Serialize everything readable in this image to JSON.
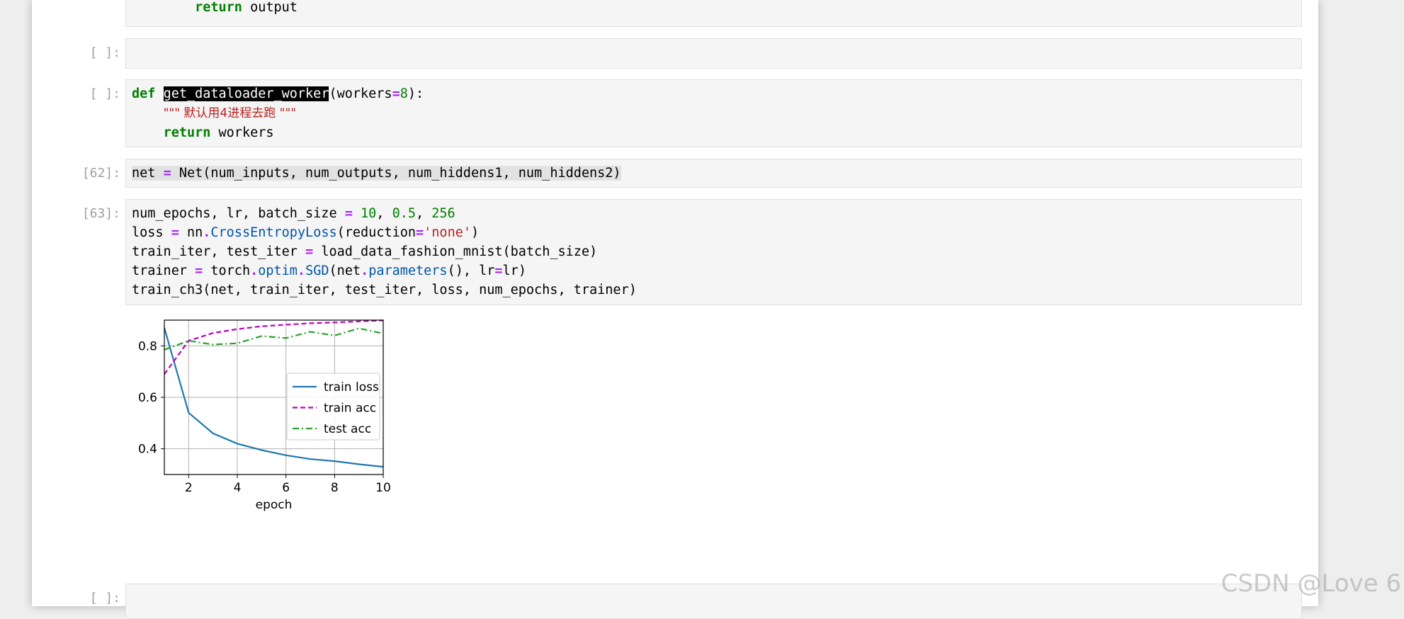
{
  "cells": [
    {
      "prompt": "",
      "lines": [
        [
          {
            "t": "        "
          },
          {
            "t": "return",
            "c": "kw"
          },
          {
            "t": " output"
          }
        ]
      ]
    },
    {
      "prompt": "[ ]:",
      "lines": [
        [
          {
            "t": ""
          }
        ]
      ]
    },
    {
      "prompt": "[ ]:",
      "lines": [
        [
          {
            "t": "def",
            "c": "kw"
          },
          {
            "t": " "
          },
          {
            "t": "get_dataloader_worker",
            "c": "sel"
          },
          {
            "t": "(workers"
          },
          {
            "t": "=",
            "c": "op"
          },
          {
            "t": "8",
            "c": "num"
          },
          {
            "t": "):"
          }
        ],
        [
          {
            "t": "    "
          },
          {
            "t": "\"\"\" 默认用4进程去跑 \"\"\"",
            "c": "str"
          }
        ],
        [
          {
            "t": "    "
          },
          {
            "t": "return",
            "c": "kw"
          },
          {
            "t": " workers"
          }
        ]
      ]
    },
    {
      "prompt": "[62]:",
      "lines": [
        [
          {
            "t": "net ",
            "c": "hl"
          },
          {
            "t": "=",
            "c": "op hl"
          },
          {
            "t": " Net(num_inputs, num_outputs, num_hiddens1, num_hiddens2)",
            "c": "hl"
          }
        ]
      ]
    },
    {
      "prompt": "[63]:",
      "lines": [
        [
          {
            "t": "num_epochs, lr, batch_size "
          },
          {
            "t": "=",
            "c": "op"
          },
          {
            "t": " "
          },
          {
            "t": "10",
            "c": "num"
          },
          {
            "t": ", "
          },
          {
            "t": "0.5",
            "c": "num"
          },
          {
            "t": ", "
          },
          {
            "t": "256",
            "c": "num"
          }
        ],
        [
          {
            "t": "loss "
          },
          {
            "t": "=",
            "c": "op"
          },
          {
            "t": " nn"
          },
          {
            "t": ".",
            "c": "op"
          },
          {
            "t": "CrossEntropyLoss",
            "c": "fn"
          },
          {
            "t": "(reduction"
          },
          {
            "t": "=",
            "c": "op"
          },
          {
            "t": "'none'",
            "c": "str"
          },
          {
            "t": ")"
          }
        ],
        [
          {
            "t": "train_iter, test_iter "
          },
          {
            "t": "=",
            "c": "op"
          },
          {
            "t": " load_data_fashion_mnist(batch_size)"
          }
        ],
        [
          {
            "t": "trainer "
          },
          {
            "t": "=",
            "c": "op"
          },
          {
            "t": " torch"
          },
          {
            "t": ".",
            "c": "op"
          },
          {
            "t": "optim",
            "c": "fn"
          },
          {
            "t": ".",
            "c": "op"
          },
          {
            "t": "SGD",
            "c": "fn"
          },
          {
            "t": "(net"
          },
          {
            "t": ".",
            "c": "op"
          },
          {
            "t": "parameters",
            "c": "fn"
          },
          {
            "t": "(), lr"
          },
          {
            "t": "=",
            "c": "op"
          },
          {
            "t": "lr)"
          }
        ],
        [
          {
            "t": "train_ch3(net, train_iter, test_iter, loss, num_epochs, trainer)"
          }
        ]
      ]
    },
    {
      "prompt": "[ ]:",
      "lines": [
        [
          {
            "t": ""
          }
        ]
      ]
    }
  ],
  "chart_data": {
    "type": "line",
    "xlabel": "epoch",
    "ylabel": "",
    "xlim": [
      1,
      10
    ],
    "ylim": [
      0.3,
      0.9
    ],
    "xticks": [
      "2",
      "4",
      "6",
      "8",
      "10"
    ],
    "yticks": [
      "0.4",
      "0.6",
      "0.8"
    ],
    "grid": true,
    "legend_position": "center-right",
    "series": [
      {
        "name": "train loss",
        "color": "#1f77b4",
        "style": "solid",
        "x": [
          1,
          2,
          3,
          4,
          5,
          6,
          7,
          8,
          9,
          10
        ],
        "values": [
          0.87,
          0.54,
          0.46,
          0.42,
          0.395,
          0.375,
          0.36,
          0.352,
          0.34,
          0.33
        ]
      },
      {
        "name": "train acc",
        "color": "#bf00bf",
        "style": "dashed",
        "x": [
          1,
          2,
          3,
          4,
          5,
          6,
          7,
          8,
          9,
          10
        ],
        "values": [
          0.69,
          0.82,
          0.85,
          0.865,
          0.876,
          0.882,
          0.888,
          0.891,
          0.895,
          0.899
        ]
      },
      {
        "name": "test acc",
        "color": "#2ca02c",
        "style": "dashdot",
        "x": [
          1,
          2,
          3,
          4,
          5,
          6,
          7,
          8,
          9,
          10
        ],
        "values": [
          0.785,
          0.82,
          0.805,
          0.81,
          0.838,
          0.83,
          0.855,
          0.84,
          0.868,
          0.848
        ]
      }
    ]
  },
  "watermark": "CSDN @Love 6"
}
